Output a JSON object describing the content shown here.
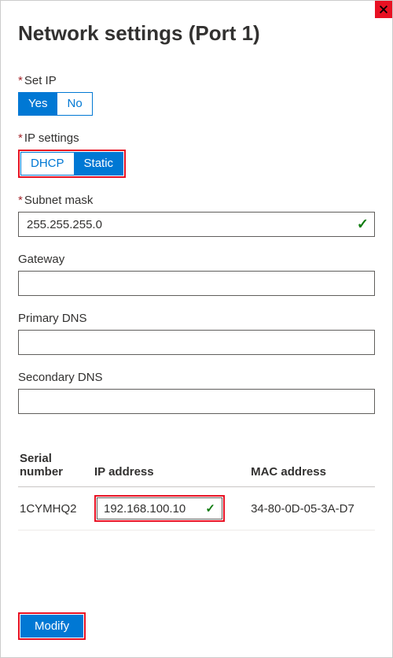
{
  "title": "Network settings (Port 1)",
  "setIp": {
    "label": "Set IP",
    "yes": "Yes",
    "no": "No"
  },
  "ipSettings": {
    "label": "IP settings",
    "dhcp": "DHCP",
    "static": "Static"
  },
  "subnet": {
    "label": "Subnet mask",
    "value": "255.255.255.0"
  },
  "gateway": {
    "label": "Gateway",
    "value": ""
  },
  "primaryDns": {
    "label": "Primary DNS",
    "value": ""
  },
  "secondaryDns": {
    "label": "Secondary DNS",
    "value": ""
  },
  "table": {
    "headers": {
      "serial": "Serial number",
      "ip": "IP address",
      "mac": "MAC address"
    },
    "row": {
      "serial": "1CYMHQ2",
      "ip": "192.168.100.10",
      "mac": "34-80-0D-05-3A-D7"
    }
  },
  "modify": "Modify"
}
